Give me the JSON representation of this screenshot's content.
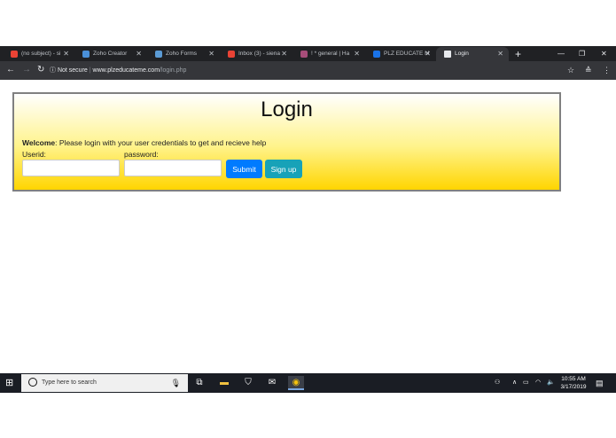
{
  "browser": {
    "tabs": [
      {
        "title": "(no subject) - si",
        "color": "#ea4335"
      },
      {
        "title": "Zoho Creator",
        "color": "#4a90d9"
      },
      {
        "title": "Zoho Forms",
        "color": "#5b9bd5"
      },
      {
        "title": "Inbox (3) - siena",
        "color": "#ea4335"
      },
      {
        "title": "! * general | Ha",
        "color": "#a64d79"
      },
      {
        "title": "PLZ EDUCATE M",
        "color": "#1a73e8"
      },
      {
        "title": "Login",
        "color": "#e8eaed"
      }
    ],
    "address": {
      "security": "Not secure",
      "domain": "www.plzeducateme.com",
      "path": "/login.php"
    }
  },
  "form": {
    "title": "Login",
    "welcome_bold": "Welcome",
    "welcome_text": ": Please login with your user credentials to get and recieve help",
    "userid_label": "Userid:",
    "password_label": "password:",
    "userid_value": "",
    "password_value": "",
    "submit_label": "Submit",
    "signup_label": "Sign up",
    "colors": {
      "submit": "#007bff",
      "signup": "#17a2b8"
    }
  },
  "taskbar": {
    "search_placeholder": "Type here to search",
    "time": "10:55 AM",
    "date": "3/17/2019"
  }
}
